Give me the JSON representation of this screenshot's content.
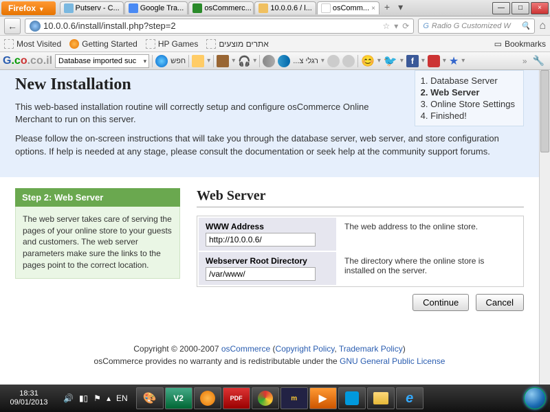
{
  "browser": {
    "menu_label": "Firefox",
    "tabs": [
      {
        "label": "Putserv - C...",
        "icon_color": "#7ab8e0"
      },
      {
        "label": "Google Tra...",
        "icon_color": "#4a8af4"
      },
      {
        "label": "osCommerc...",
        "icon_color": "#2a8a2a"
      },
      {
        "label": "10.0.0.6 / l...",
        "icon_color": "#f0c060"
      },
      {
        "label": "osComm...",
        "icon_color": "#ffffff"
      }
    ],
    "url": "10.0.0.6/install/install.php?step=2",
    "search_placeholder": "Radio G Customized W",
    "bookmarks": {
      "most_visited": "Most Visited",
      "getting_started": "Getting Started",
      "hp_games": "HP Games",
      "sites": "אתרים מוצעים",
      "bookmarks_label": "Bookmarks"
    },
    "toolbar2": {
      "logo_suffix": ".co.il",
      "db_msg": "Database imported suc",
      "search_label": "חפש",
      "radio_label": "...רגלי צ"
    }
  },
  "page": {
    "title": "New Installation",
    "intro1": "This web-based installation routine will correctly setup and configure osCommerce Online Merchant to run on this server.",
    "intro2": "Please follow the on-screen instructions that will take you through the database server, web server, and store configuration options. If help is needed at any stage, please consult the documentation or seek help at the community support forums.",
    "steps": [
      "Database Server",
      "Web Server",
      "Online Store Settings",
      "Finished!"
    ],
    "current_step_index": 1,
    "side_title": "Step 2: Web Server",
    "side_body": "The web server takes care of serving the pages of your online store to your guests and customers. The web server parameters make sure the links to the pages point to the correct location.",
    "main_heading": "Web Server",
    "fields": {
      "www_label": "WWW Address",
      "www_value": "http://10.0.0.6/",
      "www_desc": "The web address to the online store.",
      "root_label": "Webserver Root Directory",
      "root_value": "/var/www/",
      "root_desc": "The directory where the online store is installed on the server."
    },
    "buttons": {
      "continue": "Continue",
      "cancel": "Cancel"
    },
    "footer": {
      "copyright_prefix": "Copyright © 2000-2007 ",
      "osc": "osCommerce",
      "copyright_policy": "Copyright Policy",
      "trademark_policy": "Trademark Policy",
      "line2_prefix": "osCommerce provides no warranty and is redistributable under the ",
      "gpl": "GNU General Public License"
    }
  },
  "taskbar": {
    "time": "18:31",
    "date": "09/01/2013",
    "lang": "EN"
  }
}
